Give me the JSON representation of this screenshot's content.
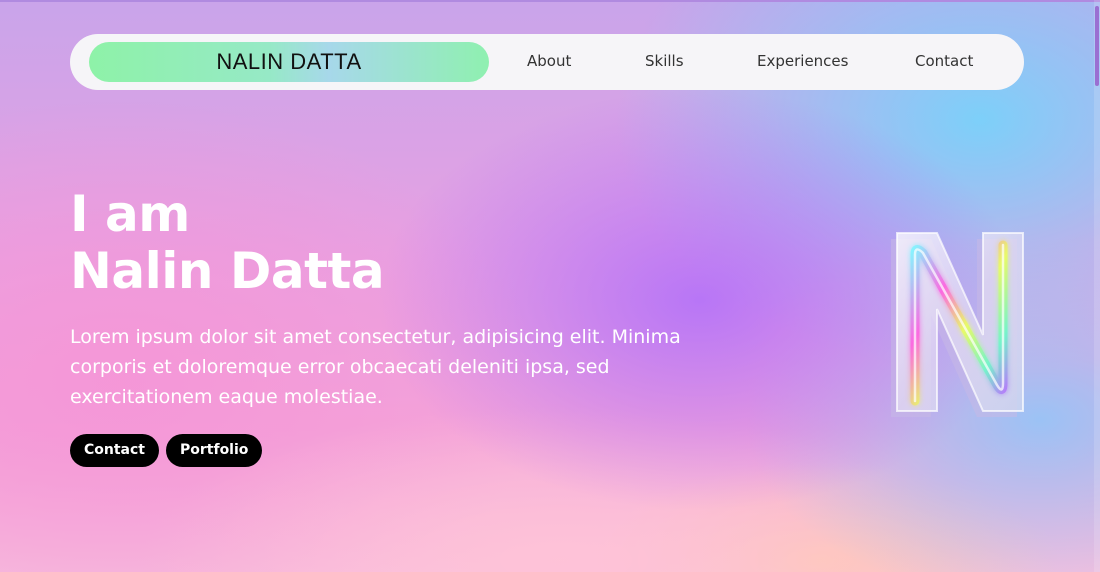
{
  "header": {
    "brand": "NALIN DATTA",
    "nav": [
      "About",
      "Skills",
      "Experiences",
      "Contact"
    ]
  },
  "hero": {
    "title_line1": "I am",
    "title_line2": "Nalin Datta",
    "description": "Lorem ipsum dolor sit amet consectetur, adipisicing elit. Minima corporis et doloremque error obcaecati deleniti ipsa, sed exercitationem eaque molestiae.",
    "buttons": [
      "Contact",
      "Portfolio"
    ]
  },
  "logo": {
    "icon": "neon-letter-n-icon",
    "letter": "N"
  },
  "colors": {
    "brand_gradient_start": "#8ef2a8",
    "brand_gradient_end": "#a7d8ea",
    "button_bg": "#000000",
    "hero_text": "#ffffff"
  }
}
